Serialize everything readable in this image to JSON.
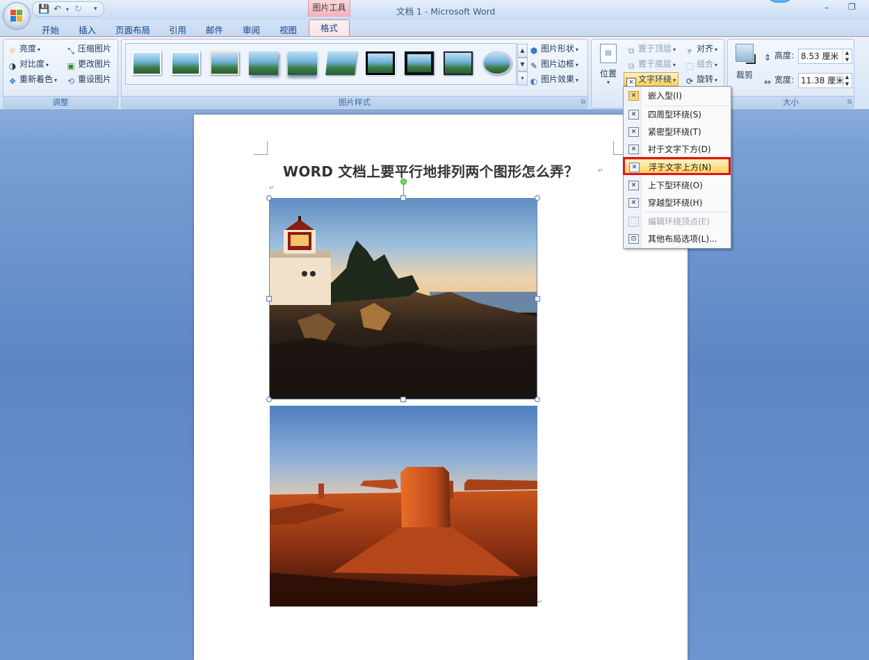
{
  "window": {
    "title": "文档 1 - Microsoft Word",
    "context_tab_group": "图片工具",
    "minimize": "–",
    "maximize": "❐"
  },
  "tabs": [
    "开始",
    "插入",
    "页面布局",
    "引用",
    "邮件",
    "审阅",
    "视图"
  ],
  "active_tab": "格式",
  "ribbon": {
    "adjust": {
      "label": "调整",
      "brightness": "亮度",
      "contrast": "对比度",
      "recolor": "重新着色",
      "compress": "压缩图片",
      "change": "更改图片",
      "reset": "重设图片"
    },
    "styles": {
      "label": "图片样式",
      "shape": "图片形状",
      "border": "图片边框",
      "effects": "图片效果"
    },
    "arrange": {
      "position": "位置",
      "bring_front": "置于顶层",
      "send_back": "置于底层",
      "text_wrap": "文字环绕",
      "align": "对齐",
      "group": "组合",
      "rotate": "旋转"
    },
    "size": {
      "label": "大小",
      "crop": "裁剪",
      "height_label": "高度:",
      "height_value": "8.53 厘米",
      "width_label": "宽度:",
      "width_value": "11.38 厘米"
    }
  },
  "document": {
    "title": "WORD 文档上要平行地排列两个图形怎么弄？",
    "para_mark": "↵"
  },
  "wrap_menu": {
    "items": [
      {
        "label": "嵌入型(I)",
        "state": "normal"
      },
      {
        "label": "四周型环绕(S)",
        "state": "normal"
      },
      {
        "label": "紧密型环绕(T)",
        "state": "normal"
      },
      {
        "label": "衬于文字下方(D)",
        "state": "normal"
      },
      {
        "label": "浮于文字上方(N)",
        "state": "highlighted"
      },
      {
        "label": "上下型环绕(O)",
        "state": "normal"
      },
      {
        "label": "穿越型环绕(H)",
        "state": "normal"
      },
      {
        "label": "编辑环绕顶点(E)",
        "state": "disabled"
      },
      {
        "label": "其他布局选项(L)...",
        "state": "normal"
      }
    ]
  },
  "colors": {
    "highlight_box": "#e0131d",
    "context_tab": "#f1b2bc"
  }
}
